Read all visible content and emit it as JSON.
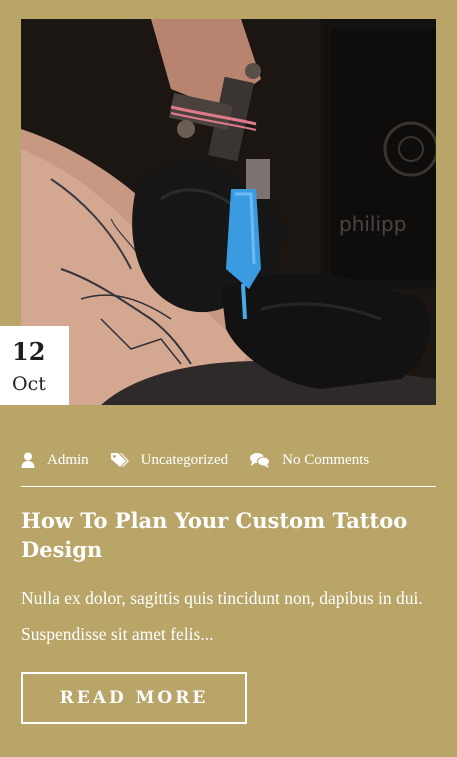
{
  "post": {
    "image_alt": "Tattoo artist working on an arm",
    "date": {
      "day": "12",
      "month": "Oct"
    },
    "meta": {
      "author": "Admin",
      "category": "Uncategorized",
      "comments": "No Comments"
    },
    "title": "How To Plan Your Custom Tattoo Design",
    "excerpt": "Nulla ex dolor, sagittis quis tincidunt non, dapibus in dui. Suspendisse sit amet felis...",
    "read_more": "READ MORE"
  },
  "colors": {
    "background": "#b9a568",
    "text": "#ffffff",
    "badge": "#ffffff"
  },
  "icons": [
    "user-icon",
    "tags-icon",
    "comments-icon"
  ]
}
